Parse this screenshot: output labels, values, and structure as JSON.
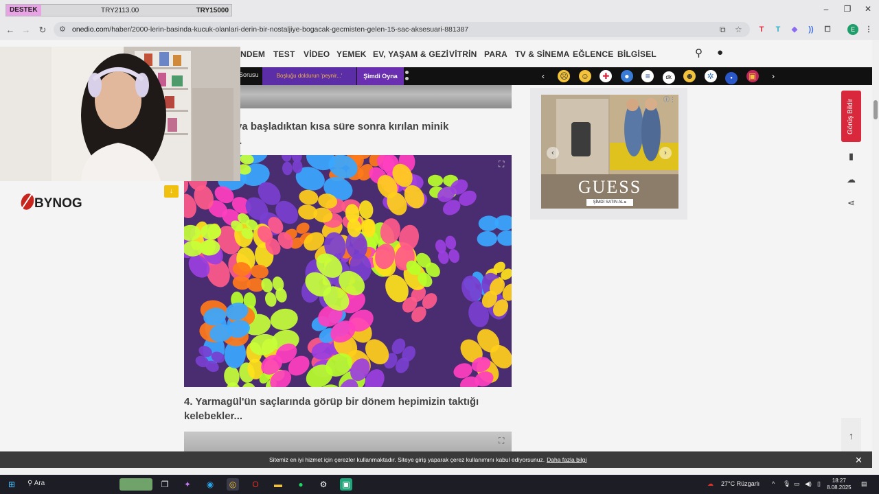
{
  "donation": {
    "label": "DESTEK",
    "current": "TRY2113.00",
    "goal": "TRY15000"
  },
  "window": {
    "minimize": "–",
    "restore": "❐",
    "close": "✕"
  },
  "browser": {
    "url_domain": "onedio.com",
    "url_path": "/haber/2000-lerin-basinda-kucuk-olanlari-derin-bir-nostaljiye-bogacak-gecmisten-gelen-15-sac-aksesuari-881387"
  },
  "site_nav": [
    "NDEM",
    "TEST",
    "VİDEO",
    "YEMEK",
    "EV, YAŞAM & GEZİ",
    "VİTRİN",
    "PARA",
    "TV & SİNEMA",
    "EĞLENCE",
    "BİLGİSEL"
  ],
  "promo_strip": {
    "item1": "Sorusu",
    "item2": "Boşluğu doldurun 'peynir...'",
    "item3": "Şimdi Oyna"
  },
  "article": {
    "heading3_line1": "ya başladıktan kısa süre sonra kırılan minik",
    "heading3_line2": "..",
    "heading4": "4. Yarmagül'ün saçlarında görüp bir dönem hepimizin taktığı kelebekler..."
  },
  "ad": {
    "brand": "GUESS",
    "cta": "ŞİMDİ SATIN AL ▸"
  },
  "feedback_label": "Görüş Bildir",
  "stream": {
    "logo": "BYNOG"
  },
  "cookie": {
    "text": "Sitemiz en iyi hizmet için çerezler kullanmaktadır. Siteye giriş yaparak çerez kullanımını kabul ediyorsunuz.",
    "link": "Daha fazla bilgi"
  },
  "taskbar": {
    "search": "Ara",
    "weather": "27°C  Rüzgarlı",
    "time": "18:27",
    "date": "8.08.2025"
  },
  "colors": {
    "accent_red": "#d9283c",
    "promo_purple": "#5b2da6",
    "donation_pink": "#e7a3e3"
  }
}
